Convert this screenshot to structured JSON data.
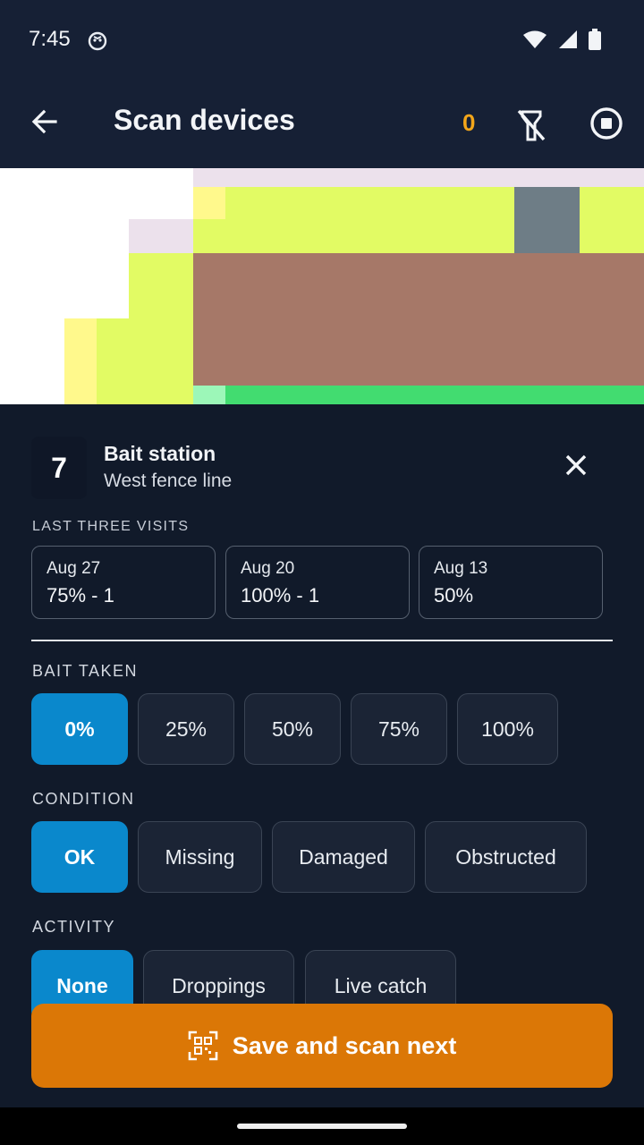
{
  "status_bar": {
    "time": "7:45"
  },
  "app_bar": {
    "title": "Scan devices",
    "counter": "0"
  },
  "device": {
    "number": "7",
    "name": "Bait station",
    "location": "West fence line"
  },
  "visits": {
    "heading": "LAST THREE VISITS",
    "items": [
      {
        "date": "Aug 27",
        "result": "75% - 1"
      },
      {
        "date": "Aug 20",
        "result": "100% - 1"
      },
      {
        "date": "Aug 13",
        "result": "50%"
      }
    ]
  },
  "bait_taken": {
    "heading": "BAIT TAKEN",
    "options": [
      "0%",
      "25%",
      "50%",
      "75%",
      "100%"
    ],
    "selected": "0%"
  },
  "condition": {
    "heading": "CONDITION",
    "options": [
      "OK",
      "Missing",
      "Damaged",
      "Obstructed"
    ],
    "selected": "OK"
  },
  "activity": {
    "heading": "ACTIVITY",
    "options": [
      "None",
      "Droppings",
      "Live catch"
    ],
    "selected": "None"
  },
  "action": {
    "save_label": "Save and scan next"
  },
  "colors": {
    "accent": "#0a88cc",
    "action": "#db7706",
    "counter": "#f3a61a",
    "background": "#111a2a"
  }
}
